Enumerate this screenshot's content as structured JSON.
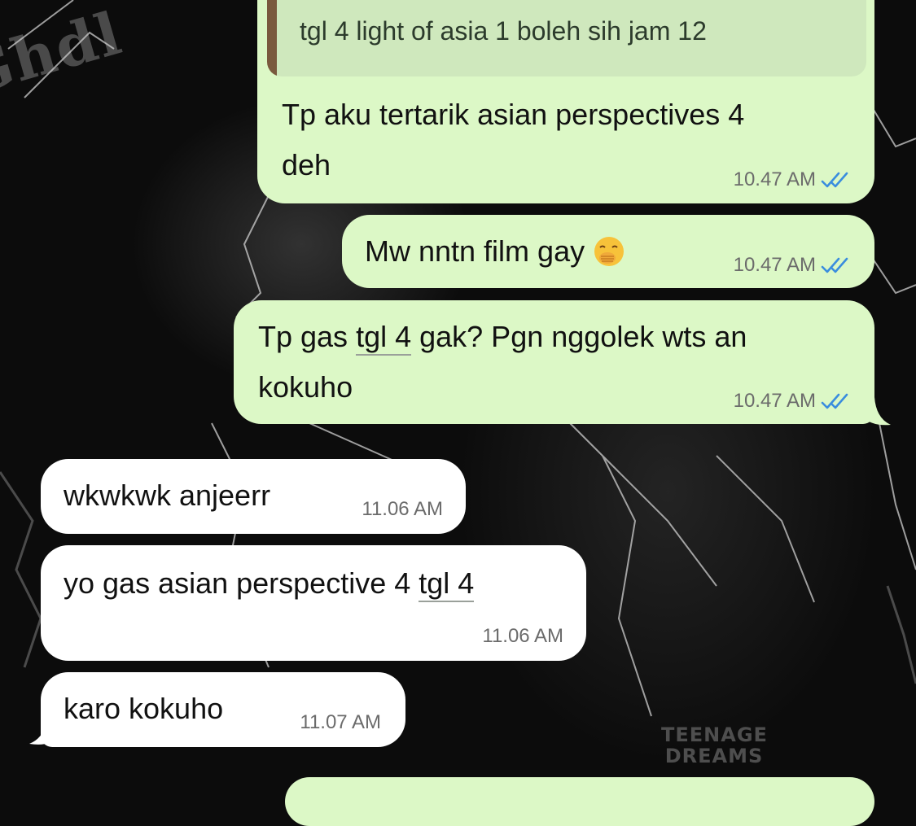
{
  "quote": {
    "text": "tgl 4 light of asia 1 boleh sih jam 12"
  },
  "messages": [
    {
      "direction": "outgoing",
      "text": "Tp aku tertarik asian perspectives 4 deh",
      "line1": "Tp aku tertarik asian perspectives 4",
      "line2": "deh",
      "time": "10.47 AM",
      "status": "read"
    },
    {
      "direction": "outgoing",
      "text": "Mw nntn film gay 🤭",
      "line1": "Mw nntn film gay",
      "emoji": "hand-over-mouth-emoji",
      "time": "10.47 AM",
      "status": "read"
    },
    {
      "direction": "outgoing",
      "line1_pre": "Tp gas ",
      "line1_link": "tgl 4",
      "line1_post": " gak? Pgn nggolek wts an",
      "line2": "kokuho",
      "time": "10.47 AM",
      "status": "read"
    },
    {
      "direction": "incoming",
      "text": "wkwkwk anjeerr",
      "time": "11.06 AM"
    },
    {
      "direction": "incoming",
      "text_pre": "yo gas asian perspective 4 ",
      "text_link": "tgl 4",
      "time": "11.06 AM"
    },
    {
      "direction": "incoming",
      "text": "karo kokuho",
      "time": "11.07 AM"
    }
  ],
  "wallpaper": {
    "gothic_text": "Ghdl",
    "print_text": "TEENAGE DREAMS"
  },
  "colors": {
    "outgoing_bubble": "#dcf8c6",
    "incoming_bubble": "#ffffff",
    "read_ticks": "#3a8dde",
    "background": "#0c0c0c"
  }
}
